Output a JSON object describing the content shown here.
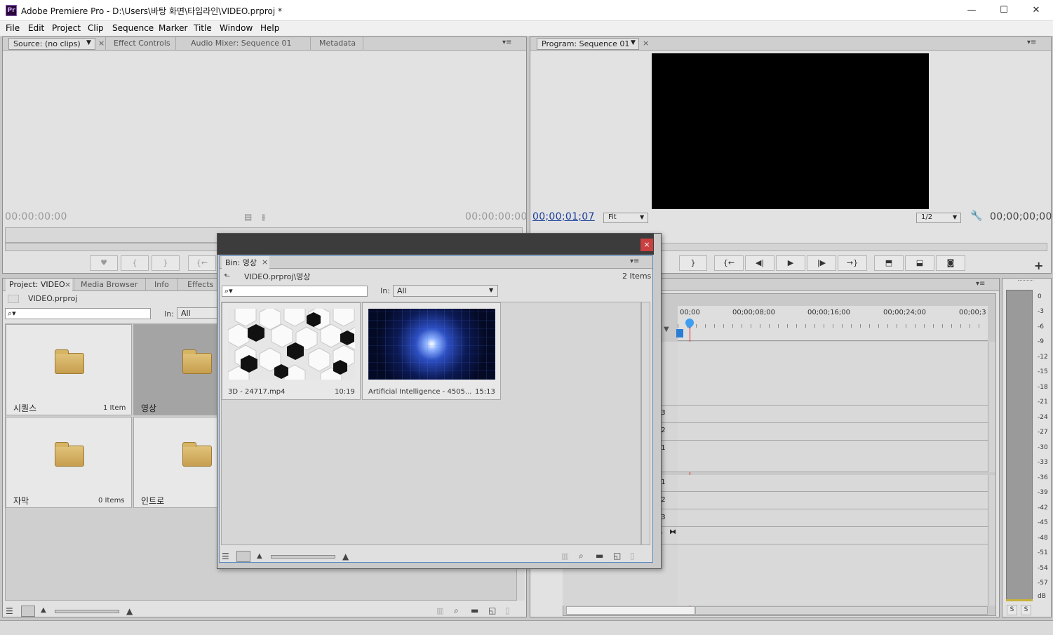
{
  "window": {
    "title": "Adobe Premiere Pro - D:\\Users\\바탕 화면\\타임라인\\VIDEO.prproj *",
    "app_icon": "Pr",
    "minimize": "—",
    "maximize": "☐",
    "close": "✕"
  },
  "menu": [
    "File",
    "Edit",
    "Project",
    "Clip",
    "Sequence",
    "Marker",
    "Title",
    "Window",
    "Help"
  ],
  "source_panel": {
    "tabs": [
      "Source: (no clips)",
      "Effect Controls",
      "Audio Mixer: Sequence 01",
      "Metadata"
    ],
    "timecode_left": "00:00:00:00",
    "timecode_right": "00:00:00:00"
  },
  "program_panel": {
    "tab": "Program: Sequence 01",
    "timecode": "00;00;01;07",
    "fit": "Fit",
    "resolution": "1/2",
    "timecode_right": "00;00;00;00"
  },
  "project_panel": {
    "tabs": [
      "Project: VIDEO",
      "Media Browser",
      "Info",
      "Effects"
    ],
    "file": "VIDEO.prproj",
    "in_label": "In:",
    "in_value": "All",
    "bins": [
      {
        "name": "시퀀스",
        "count": "1 Item"
      },
      {
        "name": "영상",
        "count": ""
      },
      {
        "name": "자막",
        "count": "0 Items"
      },
      {
        "name": "인트로",
        "count": ""
      }
    ]
  },
  "bin_window": {
    "tab": "Bin: 영상",
    "path": "VIDEO.prproj\\영상",
    "count": "2 Items",
    "in_label": "In:",
    "in_value": "All",
    "clips": [
      {
        "name": "3D - 24717.mp4",
        "duration": "10:19"
      },
      {
        "name": "Artificial Intelligence - 4505...",
        "duration": "15:13"
      }
    ]
  },
  "timeline": {
    "ruler": [
      "00;00",
      "00;00;08;00",
      "00;00;16;00",
      "00;00;24;00",
      "00;00;3"
    ],
    "tracks_upper": [
      "o 3",
      "o 2",
      "o 1"
    ],
    "tracks_lower": [
      "o 1",
      "o 2",
      "o 3",
      "ter"
    ]
  },
  "meter": {
    "labels": [
      "0",
      "-3",
      "-6",
      "-9",
      "-12",
      "-15",
      "-18",
      "-21",
      "-24",
      "-27",
      "-30",
      "-33",
      "-36",
      "-39",
      "-42",
      "-45",
      "-48",
      "-51",
      "-54",
      "-57",
      "dB"
    ],
    "solo": [
      "S",
      "S"
    ]
  }
}
